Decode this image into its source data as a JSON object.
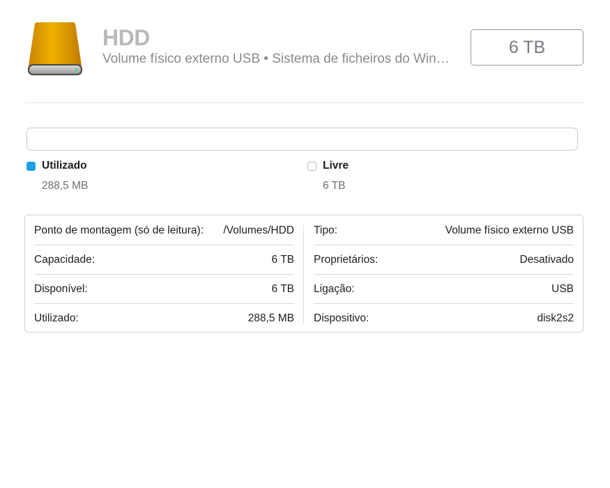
{
  "header": {
    "title": "HDD",
    "subtitle": "Volume físico externo USB • Sistema de ficheiros do Windo...",
    "capacity": "6 TB",
    "icon": "external-drive-icon"
  },
  "usage": {
    "used_fraction": 5e-05,
    "colors": {
      "used": "#1ba1e2",
      "free": "#ffffff"
    },
    "legend": [
      {
        "label": "Utilizado",
        "value": "288,5 MB"
      },
      {
        "label": "Livre",
        "value": "6 TB"
      }
    ]
  },
  "info": {
    "left": [
      {
        "key": "Ponto de montagem (só de leitura):",
        "value": "/Volumes/HDD"
      },
      {
        "key": "Capacidade:",
        "value": "6 TB"
      },
      {
        "key": "Disponível:",
        "value": "6 TB"
      },
      {
        "key": "Utilizado:",
        "value": "288,5 MB"
      }
    ],
    "right": [
      {
        "key": "Tipo:",
        "value": "Volume físico externo USB"
      },
      {
        "key": "Proprietários:",
        "value": "Desativado"
      },
      {
        "key": "Ligação:",
        "value": "USB"
      },
      {
        "key": "Dispositivo:",
        "value": "disk2s2"
      }
    ]
  }
}
